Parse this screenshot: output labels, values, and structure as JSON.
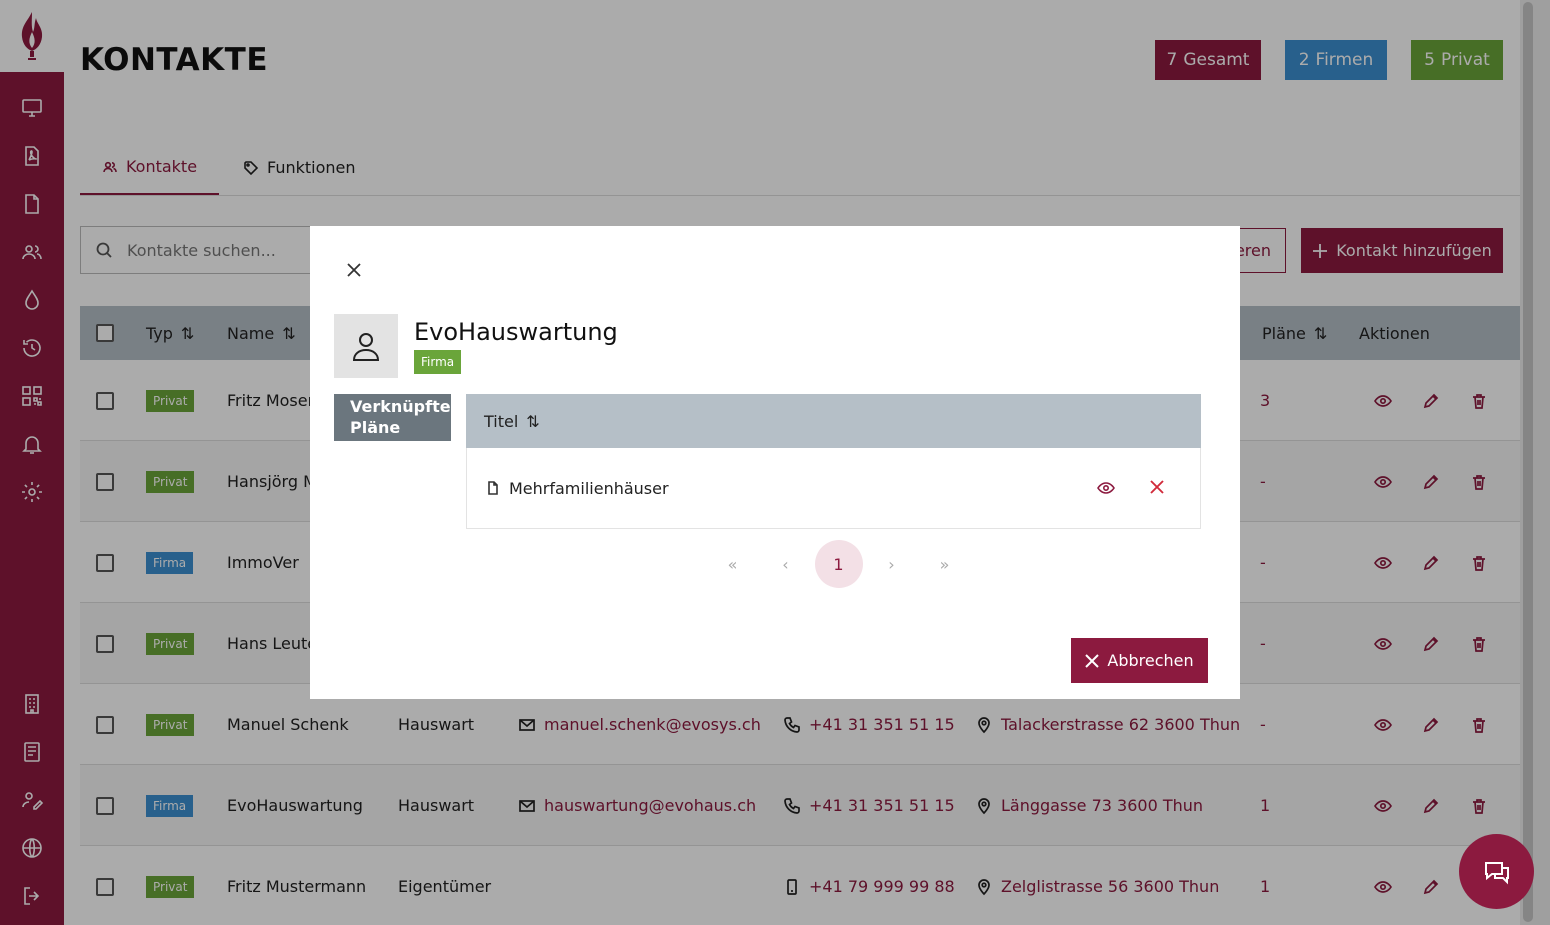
{
  "page": {
    "title": "KONTAKTE"
  },
  "stats": [
    {
      "count": "7",
      "label": "Gesamt",
      "color": "#8c1a3f"
    },
    {
      "count": "2",
      "label": "Firmen",
      "color": "#3d8fd1"
    },
    {
      "count": "5",
      "label": "Privat",
      "color": "#6aa53a"
    }
  ],
  "tabs": [
    {
      "label": "Kontakte",
      "icon": "users-icon",
      "active": true
    },
    {
      "label": "Funktionen",
      "icon": "tag-icon",
      "active": false
    }
  ],
  "search": {
    "placeholder": "Kontakte suchen..."
  },
  "toolbar": {
    "export_label": "eren",
    "add_label": "Kontakt hinzufügen"
  },
  "table": {
    "headers": {
      "typ": "Typ",
      "name": "Name",
      "plaene": "Pläne",
      "aktionen": "Aktionen"
    },
    "rows": [
      {
        "typ": "Privat",
        "name": "Fritz Moser",
        "funktion": "",
        "email": "",
        "phone": "",
        "address": "",
        "plaene": "3"
      },
      {
        "typ": "Privat",
        "name": "Hansjörg M",
        "funktion": "",
        "email": "",
        "phone": "",
        "address": "",
        "plaene": "-"
      },
      {
        "typ": "Firma",
        "name": "ImmoVer",
        "funktion": "",
        "email": "",
        "phone": "",
        "address": "",
        "plaene": "-"
      },
      {
        "typ": "Privat",
        "name": "Hans Leute",
        "funktion": "",
        "email": "",
        "phone": "",
        "address": "",
        "plaene": "-"
      },
      {
        "typ": "Privat",
        "name": "Manuel Schenk",
        "funktion": "Hauswart",
        "email": "manuel.schenk@evosys.ch",
        "phone": "+41 31 351 51 15",
        "address": "Talackerstrasse 62 3600 Thun",
        "plaene": "-"
      },
      {
        "typ": "Firma",
        "name": "EvoHauswartung",
        "funktion": "Hauswart",
        "email": "hauswartung@evohaus.ch",
        "phone": "+41 31 351 51 15",
        "address": "Länggasse 73 3600 Thun",
        "plaene": "1"
      },
      {
        "typ": "Privat",
        "name": "Fritz Mustermann",
        "funktion": "Eigentümer",
        "email": "",
        "phone": "+41 79 999 99 88",
        "address": "Zelglistrasse 56 3600 Thun",
        "plaene": "1"
      }
    ]
  },
  "modal": {
    "contact_name": "EvoHauswartung",
    "contact_type": "Firma",
    "side_tab_label": "Verknüpfte Pläne",
    "table_header": "Titel",
    "plans": [
      {
        "title": "Mehrfamilienhäuser"
      }
    ],
    "pager": {
      "first": "«",
      "prev": "‹",
      "current": "1",
      "next": "›",
      "last": "»"
    },
    "cancel_label": "Abbrechen"
  },
  "colors": {
    "brand": "#8c1a3f",
    "firma": "#3d8fd1",
    "privat": "#6aa53a",
    "header": "#b5bfc7"
  }
}
